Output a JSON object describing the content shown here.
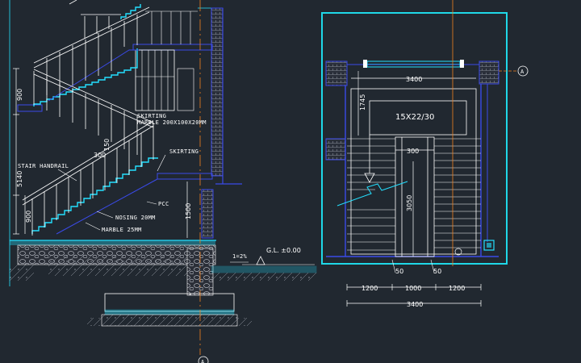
{
  "section": {
    "annotations": {
      "skirting_marble": [
        "SKIRTING",
        "MARBLE 200X100X20MM"
      ],
      "skirting": "SKIRTING",
      "stair_handrail": "STAIR HANDRAIL",
      "pcc": "PCC",
      "nosing": "NOSING 20MM",
      "marble": "MARBLE 25MM",
      "slope": "1=2%",
      "ground_level": "G.L. ±0.00"
    },
    "dims": {
      "d900_top": "900",
      "d5140": "5140",
      "d900_bottom": "900",
      "d1500": "1500",
      "d150": "150",
      "d300": "300"
    },
    "axis_label": "A"
  },
  "plan": {
    "size_label": "15X22/30",
    "dims": {
      "top_width": "3400",
      "left_depth": "1745",
      "gap": "300",
      "flight_length": "3050",
      "bottom": [
        "1200",
        "1000",
        "1200"
      ],
      "overall": "3400",
      "post_left": "50",
      "post_right": "50"
    },
    "axis_label": "A"
  },
  "colors": {
    "background": "#212830",
    "wall": "#3a4ae8",
    "frame": "#1fd8e8",
    "white": "#ffffff",
    "axis": "#f08020",
    "step": "#24e0ff",
    "grey": "#b8bec8"
  }
}
